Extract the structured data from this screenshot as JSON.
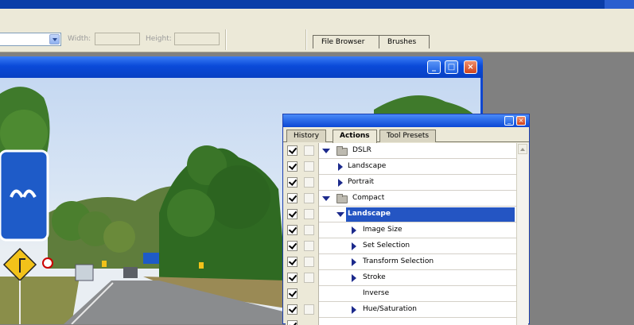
{
  "options_bar": {
    "width_label": "Width:",
    "height_label": "Height:"
  },
  "palette_well": {
    "tabs": [
      "File Browser",
      "Brushes"
    ]
  },
  "actions_palette": {
    "tabs": [
      "History",
      "Actions",
      "Tool Presets"
    ],
    "active_tab": "Actions",
    "rows": [
      {
        "label": "DSLR",
        "kind": "set",
        "expanded": true
      },
      {
        "label": "Landscape",
        "kind": "action"
      },
      {
        "label": "Portrait",
        "kind": "action"
      },
      {
        "label": "Compact",
        "kind": "set",
        "expanded": true
      },
      {
        "label": "Landscape",
        "kind": "action",
        "selected": true
      },
      {
        "label": "Image Size",
        "kind": "step"
      },
      {
        "label": "Set Selection",
        "kind": "step"
      },
      {
        "label": "Transform Selection",
        "kind": "step"
      },
      {
        "label": "Stroke",
        "kind": "step"
      },
      {
        "label": "Inverse",
        "kind": "step"
      },
      {
        "label": "Hue/Saturation",
        "kind": "step"
      }
    ]
  },
  "colors": {
    "title_blue": "#0a4ad8",
    "selection_blue": "#2455c3",
    "chrome": "#ece9d8"
  }
}
